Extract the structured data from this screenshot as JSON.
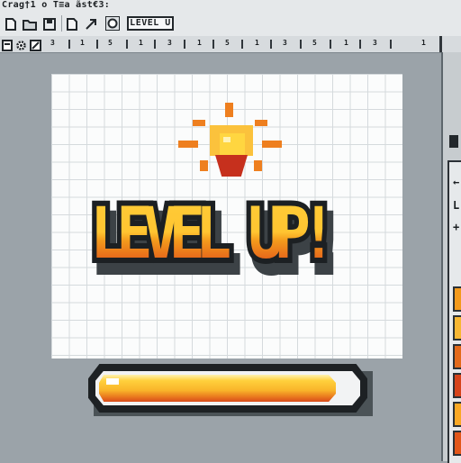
{
  "window": {
    "title": "Crag†1 o T≡a ãst€3:"
  },
  "toolbar": {
    "document_chip": "LEVEL U",
    "icons": [
      "new-file-icon",
      "open-folder-icon",
      "save-icon",
      "move-tool-icon",
      "circle-tool-icon"
    ]
  },
  "ruler": {
    "tool_icons": [
      "layer-icon",
      "gear-icon",
      "brush-icon"
    ],
    "numbers": [
      "3",
      "1",
      "5",
      "1",
      "3",
      "1",
      "5",
      "1",
      "3",
      "5",
      "1",
      "3",
      "1"
    ]
  },
  "side_panel": {
    "tools": [
      "←",
      "L",
      "+"
    ],
    "swatch_colors": [
      "#f39a1c",
      "#f7b733",
      "#e36a1a",
      "#d6441b",
      "#f9a825",
      "#e2571a"
    ]
  },
  "artwork": {
    "headline": "LEVEL UP!",
    "progress": 0.92,
    "colors": {
      "face_top": "#ffcf3a",
      "face_bottom": "#d6441b",
      "outline": "#1c2023",
      "lamp": "#f5a623",
      "ray": "#ee7f1f"
    }
  }
}
